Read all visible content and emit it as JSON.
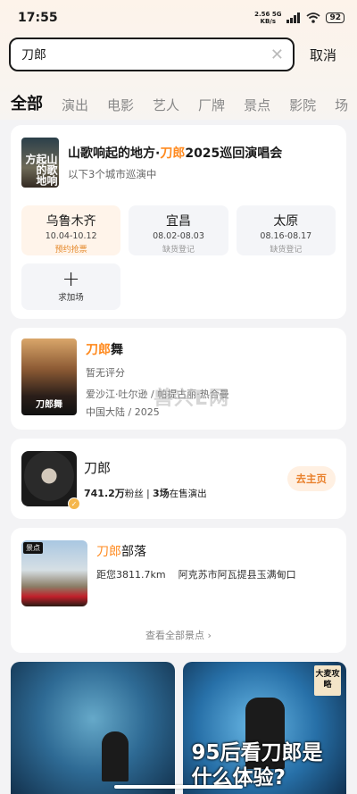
{
  "status_bar": {
    "time": "17:55",
    "net_speed_value": "2.56",
    "net_speed_unit": "KB/s",
    "net_type": "5G",
    "battery": "92"
  },
  "search": {
    "query": "刀郎",
    "clear_icon": "close-icon",
    "cancel_label": "取消"
  },
  "tabs": [
    {
      "label": "全部",
      "active": true
    },
    {
      "label": "演出"
    },
    {
      "label": "电影"
    },
    {
      "label": "艺人"
    },
    {
      "label": "厂牌"
    },
    {
      "label": "景点"
    },
    {
      "label": "影院"
    },
    {
      "label": "场"
    }
  ],
  "concert": {
    "poster_text": "山歌响起的地方",
    "title_prefix": "山歌响起的地方·",
    "title_highlight": "刀郎",
    "title_suffix": "2025巡回演唱会",
    "subtitle": "以下3个城市巡演中",
    "cities": [
      {
        "name": "乌鲁木齐",
        "dates": "10.04-10.12",
        "status": "预约抢票"
      },
      {
        "name": "宜昌",
        "dates": "08.02-08.03",
        "status": "缺货登记"
      },
      {
        "name": "太原",
        "dates": "08.16-08.17",
        "status": "缺货登记"
      }
    ],
    "add_label": "求加场"
  },
  "show": {
    "poster_text": "刀郎舞",
    "title_highlight": "刀郎",
    "title_suffix": "舞",
    "rating": "暂无评分",
    "cast": "爱沙江·吐尔逊 / 帕提古丽·热合曼",
    "region": "中国大陆 / 2025"
  },
  "artist": {
    "name": "刀郎",
    "fans_value": "741.2万",
    "fans_label": "粉丝",
    "shows_value": "3场",
    "shows_label": "在售演出",
    "home_button": "去主页"
  },
  "spot": {
    "tag": "景点",
    "title_highlight": "刀郎",
    "title_suffix": "部落",
    "distance": "距您3811.7km",
    "location": "阿克苏市阿瓦提县玉满甸口",
    "see_all": "查看全部景点 ›"
  },
  "feeds": [
    {
      "caption": ""
    },
    {
      "badge": "大麦攻略",
      "caption": "95后看刀郎是什么体验?"
    }
  ],
  "watermark": "兽兴E网",
  "colors": {
    "accent": "#ff8a1f",
    "hot_bg": "#fff4ea"
  }
}
